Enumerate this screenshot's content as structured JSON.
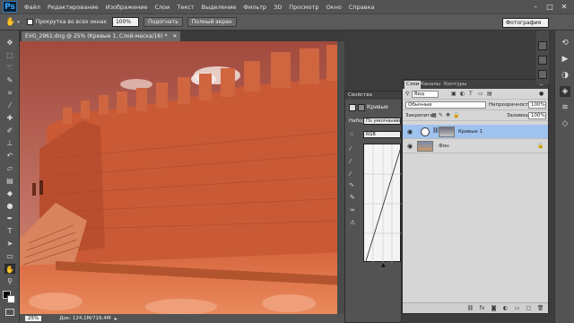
{
  "menubar": {
    "logo": "Ps",
    "items": [
      "Файл",
      "Редактирование",
      "Изображение",
      "Слои",
      "Текст",
      "Выделение",
      "Фильтр",
      "3D",
      "Просмотр",
      "Окно",
      "Справка"
    ],
    "minimize": "–",
    "maximize": "□",
    "close": "✕"
  },
  "options": {
    "scroll_all": "Прокрутка во всех окнах",
    "zoom_value": "100%",
    "fit_screen": "Подогнать",
    "full_screen": "Полный экран",
    "workspace": "Фотография"
  },
  "document": {
    "tab_title": "EVG_2961.dng @ 25% (Кривые 1, Слой-маска/16) *",
    "zoom": "25%",
    "doc_info": "Док: 124,1M/716,4M"
  },
  "properties": {
    "title": "Свойства",
    "panel_name": "Кривые",
    "preset_label": "Набор:",
    "preset_value": "По умолчанию",
    "channel": "RGB"
  },
  "layers": {
    "tabs": [
      "Слои",
      "Каналы",
      "Контуры"
    ],
    "filter": "Вид",
    "blend_mode": "Обычные",
    "opacity_label": "Непрозрачность:",
    "opacity_value": "100%",
    "lock_label": "Закрепить:",
    "fill_label": "Заливка:",
    "fill_value": "100%",
    "items": [
      {
        "name": "Кривые 1",
        "selected": true
      },
      {
        "name": "Фон",
        "selected": false
      }
    ]
  },
  "colors": {
    "accent": "#9fc3ef",
    "menubar": "#535353",
    "panel": "#d6d6d6",
    "tint": "#e8603c"
  },
  "icons": [
    "move-icon",
    "marquee-icon",
    "lasso-icon",
    "quick-select-icon",
    "crop-icon",
    "eyedropper-icon",
    "healing-icon",
    "brush-icon",
    "stamp-icon",
    "history-brush-icon",
    "eraser-icon",
    "gradient-icon",
    "blur-icon",
    "dodge-icon",
    "pen-icon",
    "type-icon",
    "path-select-icon",
    "shape-icon",
    "hand-icon",
    "zoom-icon"
  ]
}
